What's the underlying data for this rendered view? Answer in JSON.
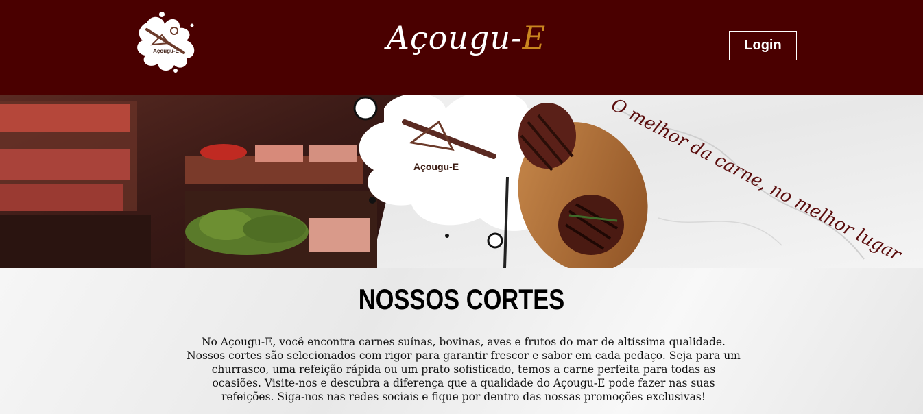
{
  "header": {
    "logo_text": "Açougu-E",
    "brand_main": "Açougu-",
    "brand_accent": "E",
    "login_label": "Login"
  },
  "banner": {
    "badge_text": "Açougu-E",
    "tagline": "O melhor da carne, no melhor lugar"
  },
  "main": {
    "section_title": "NOSSOS CORTES",
    "section_text": "No Açougu-E, você encontra carnes suínas, bovinas, aves e frutos do mar de altíssima qualidade. Nossos cortes são selecionados com rigor para garantir frescor e sabor em cada pedaço. Seja para um churrasco, uma refeição rápida ou um prato sofisticado, temos a carne perfeita para todas as ocasiões. Visite-nos e descubra a diferença que a qualidade do Açougu-E pode fazer nas suas refeições. Siga-nos nas redes sociais e fique por dentro das nossas promoções exclusivas!"
  },
  "colors": {
    "header_bg": "#4a0000",
    "accent": "#c9861f",
    "tagline": "#5a0c0c"
  }
}
